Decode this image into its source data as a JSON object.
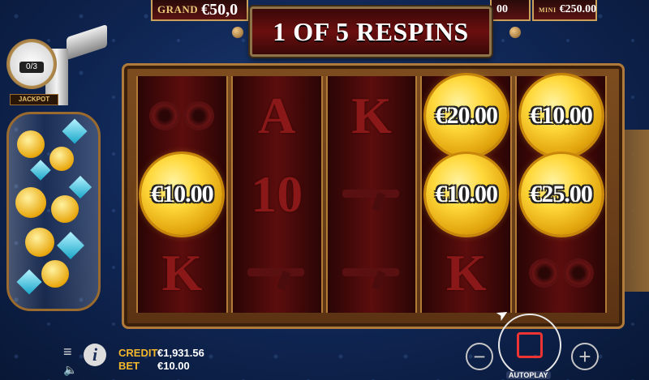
{
  "jackpots": {
    "grand_label": "GRAND",
    "grand_value": "€50,0",
    "mini_value": "00",
    "major_label": "MINI",
    "major_value": "€250.00"
  },
  "banner": {
    "text": "1 OF 5 RESPINS"
  },
  "jackpot_meter": {
    "counter": "0/3",
    "label": "JACKPOT"
  },
  "reels": [
    [
      "goggles",
      "coin:€10.00",
      "K"
    ],
    [
      "A",
      "10",
      "gun"
    ],
    [
      "K",
      "gun",
      "gun"
    ],
    [
      "coin:€20.00",
      "coin:€10.00",
      "K"
    ],
    [
      "coin:€10.00",
      "coin:€25.00",
      "goggles"
    ]
  ],
  "coins": {
    "r1c2": "€10.00",
    "r4c1": "€20.00",
    "r4c2": "€10.00",
    "r5c1": "€10.00",
    "r5c2": "€25.00"
  },
  "symbols": {
    "r2c1": "A",
    "r2c2": "10",
    "r3c1": "K",
    "r1c3": "K",
    "r4c3": "K"
  },
  "hud": {
    "credit_label": "CREDIT",
    "credit_value": "€1,931.56",
    "bet_label": "BET",
    "bet_value": "€10.00",
    "info": "i",
    "minus": "−",
    "plus": "+",
    "autoplay": "AUTOPLAY"
  },
  "colors": {
    "accent": "#f5b82a",
    "coin": "#ffd83a",
    "reel_bg": "#5c0d0d"
  }
}
